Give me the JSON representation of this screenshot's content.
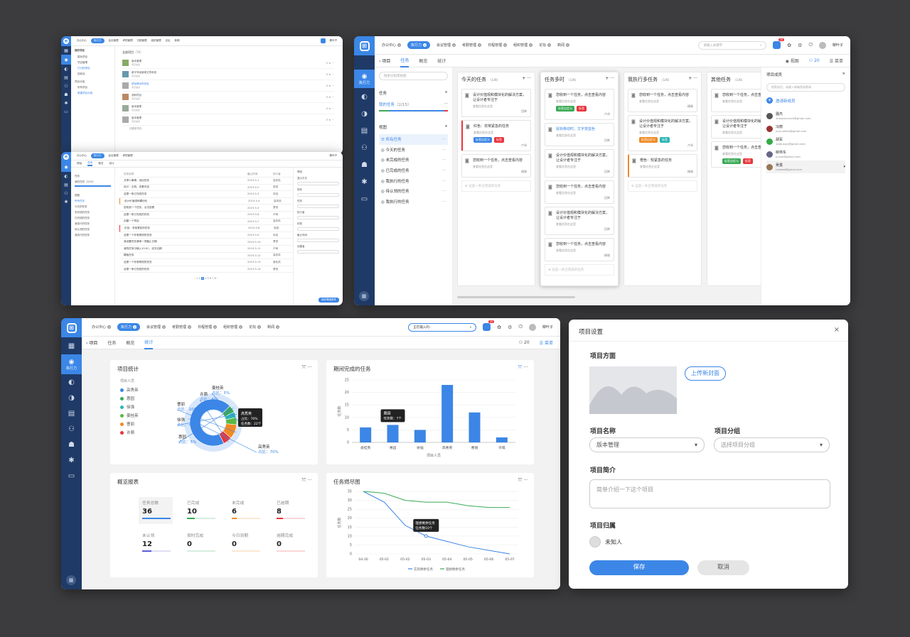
{
  "nav_tabs": [
    {
      "label": "办公中心",
      "active": false
    },
    {
      "label": "执行力",
      "active": true
    },
    {
      "label": "会议管理",
      "active": false
    },
    {
      "label": "考勤管理",
      "active": false
    },
    {
      "label": "日程管理",
      "active": false
    },
    {
      "label": "组织管理",
      "active": false
    },
    {
      "label": "论坛",
      "active": false
    },
    {
      "label": "新闻",
      "active": false
    }
  ],
  "user_name": "柳叶子",
  "notif_count": "20",
  "sidebar_active": "执行力",
  "board": {
    "search_placeholder": "请输入关键字",
    "back_label": "项目",
    "tabs": [
      "任务",
      "概览",
      "统计"
    ],
    "active_tab": "任务",
    "view_label": "视图",
    "member_count": "20",
    "menu_label": "菜单",
    "left": {
      "search_placeholder": "搜索分组或视图",
      "tasks_header": "任务",
      "my_tasks": "我的任务",
      "my_tasks_count": "（2/15）",
      "views_header": "视图",
      "views": [
        "所有任务",
        "今天的任务",
        "未完成的任务",
        "已完成的任务",
        "我执行的任务",
        "待认领的任务",
        "我执行的任务"
      ],
      "active_view": "所有任务"
    },
    "columns": [
      {
        "title": "今天的任务",
        "count": "（1/8）",
        "cards": [
          {
            "title": "设计价值观和模块化的解决方案，让设计者专注于",
            "sub": "查看信息在这里",
            "who": "回眸",
            "tags": [],
            "stripe": ""
          },
          {
            "title": "红色：非常紧急的任务",
            "sub": "查看信息在这里",
            "who": "卢泽",
            "tags": [
              {
                "text": "标签自定义",
                "color": "#3b86e6"
              },
              {
                "text": "标签",
                "color": "#e8353d"
              }
            ],
            "stripe": "#e8353d"
          },
          {
            "title": "您收到一个任务，点击查看内容",
            "sub": "查看信息在这里",
            "who": "精锄",
            "tags": [],
            "stripe": ""
          }
        ],
        "add": "这是一条已完成的任务"
      },
      {
        "title": "任务多时",
        "count": "（1/8）",
        "cards": [
          {
            "title": "您收到一个任务，点击查看内容",
            "sub": "查看信息在这里",
            "who": "卢泽",
            "tags": [
              {
                "text": "标签自定义",
                "color": "#3aaa55"
              },
              {
                "text": "标签",
                "color": "#e8353d"
              }
            ],
            "stripe": ""
          },
          {
            "title": "鼠标移动时，文字变蓝色",
            "sub": "查看信息在这里",
            "who": "回眸",
            "tags": [],
            "stripe": "",
            "blue": true
          },
          {
            "title": "设计价值观和模块化的解决方案，让设计者专注于",
            "sub": "查看信息在这里",
            "who": "回眸",
            "tags": [],
            "stripe": ""
          },
          {
            "title": "您收到一个任务，点击查看内容",
            "sub": "查看信息在这里",
            "who": "回眸",
            "tags": [],
            "stripe": ""
          },
          {
            "title": "设计价值观和模块化的解决方案，让设计者专注于",
            "sub": "查看信息在这里",
            "who": "回眸",
            "tags": [],
            "stripe": ""
          },
          {
            "title": "您收到一个任务，点击查看内容",
            "sub": "查看信息在这里",
            "who": "精锄",
            "tags": [],
            "stripe": ""
          }
        ],
        "add": "这是一条已完成的任务"
      },
      {
        "title": "我执行多任务",
        "count": "（1/8）",
        "cards": [
          {
            "title": "您收到一个任务，点击查看内容",
            "sub": "查看信息在这里",
            "who": "精锄",
            "tags": [],
            "stripe": ""
          },
          {
            "title": "设计价值观和模块化的解决方案，让设计者专注于",
            "sub": "查看信息在这里",
            "who": "卢泽",
            "tags": [
              {
                "text": "标签自定义",
                "color": "#f08a24"
              },
              {
                "text": "标签",
                "color": "#2bb5b5"
              }
            ],
            "stripe": ""
          },
          {
            "title": "橙色：较紧急的任务",
            "sub": "查看信息在这里",
            "who": "精锄",
            "tags": [],
            "stripe": "#f08a24"
          }
        ],
        "add": "这是一条已完成的任务"
      },
      {
        "title": "其他任务",
        "count": "（1/8）",
        "cards": [
          {
            "title": "您收到一个任务，点击查看内容",
            "sub": "查看信息在这里",
            "who": "精锄",
            "tags": [],
            "stripe": ""
          },
          {
            "title": "设计价值观和模块化的解决方案，让设计者专注于",
            "sub": "查看信息在这里",
            "who": "",
            "tags": [],
            "stripe": ""
          },
          {
            "title": "您收到一个任务，点击查看内容",
            "sub": "查看信息在这里",
            "who": "",
            "tags": [
              {
                "text": "标签自定义",
                "color": "#3aaa55"
              },
              {
                "text": "标签",
                "color": "#e8353d"
              }
            ],
            "stripe": ""
          }
        ],
        "add": ""
      }
    ],
    "members": {
      "title": "项目成员",
      "search_placeholder": "搜索成员，或输入邮箱直接邀请",
      "invite": "邀请新成员",
      "list": [
        {
          "name": "骚杰",
          "email": "1heyblcccxx0@gmail.com"
        },
        {
          "name": "冯丽",
          "email": "jccjcuhkkk@gmail.com"
        },
        {
          "name": "胡军",
          "email": "1jddusiyy@gmail.com"
        },
        {
          "name": "柳林东",
          "email": "k.jinei@gmail.com"
        },
        {
          "name": "吴勇",
          "email": "j.boiow@gmail.com"
        }
      ]
    }
  },
  "stats": {
    "search_placeholder": "正在输入的··",
    "back_label": "项目",
    "tabs": [
      "任务",
      "概览",
      "统计"
    ],
    "active_tab": "统计",
    "member_count": "20",
    "menu_label": "菜单",
    "panels": {
      "project_stats": "项目统计",
      "period_done": "期间完成的任务",
      "overview": "概览报表",
      "burndown": "任务燃尽图"
    },
    "project_members_label": "项目人员",
    "tooltip_donut": {
      "name": "高秀英",
      "ratio": "占比：70%",
      "count": "任务数：22个"
    },
    "tooltip_bar": {
      "name": "惠园",
      "count": "任务数：7个"
    },
    "tooltip_line": {
      "line1": "理想剩余任务",
      "line2": "任务数10个"
    },
    "overview_items": [
      {
        "label": "任务总数",
        "value": "36",
        "color": "#3b86e6",
        "fill": 1.0
      },
      {
        "label": "已完成",
        "value": "10",
        "color": "#3aaa55",
        "fill": 0.28
      },
      {
        "label": "未完成",
        "value": "6",
        "color": "#f08a24",
        "fill": 0.17
      },
      {
        "label": "已逾期",
        "value": "8",
        "color": "#e8353d",
        "fill": 0.22
      },
      {
        "label": "未认领",
        "value": "12",
        "color": "#5a5ad6",
        "fill": 0.33
      },
      {
        "label": "按时完成",
        "value": "0",
        "color": "#3aaa55",
        "fill": 0
      },
      {
        "label": "今日到期",
        "value": "0",
        "color": "#f08a24",
        "fill": 0
      },
      {
        "label": "逾期完成",
        "value": "0",
        "color": "#e8353d",
        "fill": 0
      }
    ]
  },
  "chart_data": [
    {
      "type": "pie",
      "title": "项目统计",
      "categories": [
        "高秀英",
        "惠园",
        "徐强",
        "姜桂英",
        "曹丽",
        "许萌"
      ],
      "values": [
        70,
        5,
        4,
        5,
        10,
        6
      ],
      "slice_labels": [
        "高秀英",
        "惠园",
        "徐强",
        "姜桂英",
        "曹丽",
        "许萌"
      ],
      "ratio_labels": [
        "占比：70%",
        "占比：5%",
        "占比：4%",
        "占比：5%",
        "占比：10%",
        "占比：6%"
      ],
      "colors": [
        "#3b86e6",
        "#3aaa55",
        "#2bb5b5",
        "#5ab845",
        "#f08a24",
        "#e8353d"
      ],
      "legend": "left"
    },
    {
      "type": "bar",
      "title": "期间完成的任务",
      "categories": [
        "姜桂英",
        "惠园",
        "徐强",
        "高秀英",
        "曹丽",
        "许萌"
      ],
      "values": [
        6,
        7,
        5,
        23,
        12,
        2
      ],
      "ylim": [
        0,
        25
      ],
      "yticks": [
        0,
        5,
        10,
        15,
        20,
        25
      ],
      "xlabel": "项目人员",
      "ylabel": "任务数",
      "color": "#3b86e6"
    },
    {
      "type": "line",
      "title": "任务燃尽图",
      "x": [
        "04-30",
        "05-01",
        "05-02",
        "05-03",
        "05-04",
        "05-05",
        "05-06",
        "05-07"
      ],
      "series": [
        {
          "name": "实际剩余任务",
          "values": [
            35,
            29,
            16,
            10,
            7,
            4,
            2,
            0
          ],
          "color": "#3b86e6"
        },
        {
          "name": "理想剩余任务",
          "values": [
            35,
            34,
            30,
            29,
            29,
            27,
            26,
            26
          ],
          "color": "#3aaa55"
        }
      ],
      "ylim": [
        0,
        35
      ],
      "yticks": [
        0,
        5,
        10,
        15,
        20,
        25,
        30,
        35
      ],
      "ylabel": "任务数"
    }
  ],
  "settings": {
    "title": "项目设置",
    "cover_label": "项目方面",
    "upload_label": "上传新封面",
    "name_label": "项目名称",
    "name_value": "版本管理",
    "group_label": "项目分组",
    "group_placeholder": "选择项目分组",
    "intro_label": "项目简介",
    "intro_placeholder": "简单介绍一下这个项目",
    "owner_label": "项目归属",
    "owner_value": "未知人",
    "save_label": "保存",
    "cancel_label": "取消"
  },
  "mini": {
    "list_title": "全部项目",
    "list_count": "（76）",
    "projects": [
      {
        "name": "版本管理",
        "desc": "项目描述"
      },
      {
        "name": "新宇号经新闻文章系统",
        "desc": "项目描述"
      },
      {
        "name": "鼠标移动时变色",
        "desc": "项目描述"
      },
      {
        "name": "测码项目",
        "desc": "项目描述"
      },
      {
        "name": "版本管理",
        "desc": "项目描述"
      },
      {
        "name": "版本管理",
        "desc": "项目描述"
      }
    ],
    "create_label": "创建新项目",
    "side_items": [
      "我的项目",
      "星标项目",
      "项目管理",
      "已归档项目",
      "回收站",
      "项目分组",
      "所有项目",
      "新建项目分组"
    ],
    "task_rows": [
      {
        "t": "共享小事情：添加任务",
        "d": "2019-5-1",
        "p": "高秀英"
      },
      {
        "t": "设计：文档，查看内容",
        "d": "2019-5-2",
        "p": "惠园"
      },
      {
        "t": "这是一条已完成任务",
        "d": "2019-5-3",
        "p": "徐强"
      },
      {
        "t": "设计价值观和模块化",
        "d": "2019-5-4",
        "p": "高秀英"
      },
      {
        "t": "您收到一个任务，点击查看",
        "d": "2019-5-5",
        "p": "曹丽"
      },
      {
        "t": "这是一条已完成的任务",
        "d": "2019-5-6",
        "p": "许萌"
      },
      {
        "t": "创建一个项目",
        "d": "2019-5-7",
        "p": "高秀英"
      },
      {
        "t": "红色：非常紧急的任务",
        "d": "2019-5-8",
        "p": "惠园"
      },
      {
        "t": "这是一个非常简短的任务",
        "d": "2019-5-9",
        "p": "徐强"
      },
      {
        "t": "我设置任务清单一项截止日期",
        "d": "2019-5-10",
        "p": "曹丽"
      },
      {
        "t": "我的任务中输入10.0C，这写近期",
        "d": "2019-5-11",
        "p": "许萌"
      },
      {
        "t": "模板任务",
        "d": "2019-5-12",
        "p": "高秀英"
      },
      {
        "t": "这是一个非常简短的任务",
        "d": "2019-5-13",
        "p": "姜桂英"
      },
      {
        "t": "这是一条已完成的任务",
        "d": "2019-5-14",
        "p": "曹丽"
      }
    ],
    "table_headers": [
      "任务名称",
      "截止时间",
      "执行者"
    ],
    "filter_title": "筛选",
    "filter_items": [
      "显示方式",
      "排序",
      "任务",
      "执行者",
      "标签",
      "截止时间",
      "创建者"
    ],
    "filter_btn": "保存筛选条件"
  }
}
